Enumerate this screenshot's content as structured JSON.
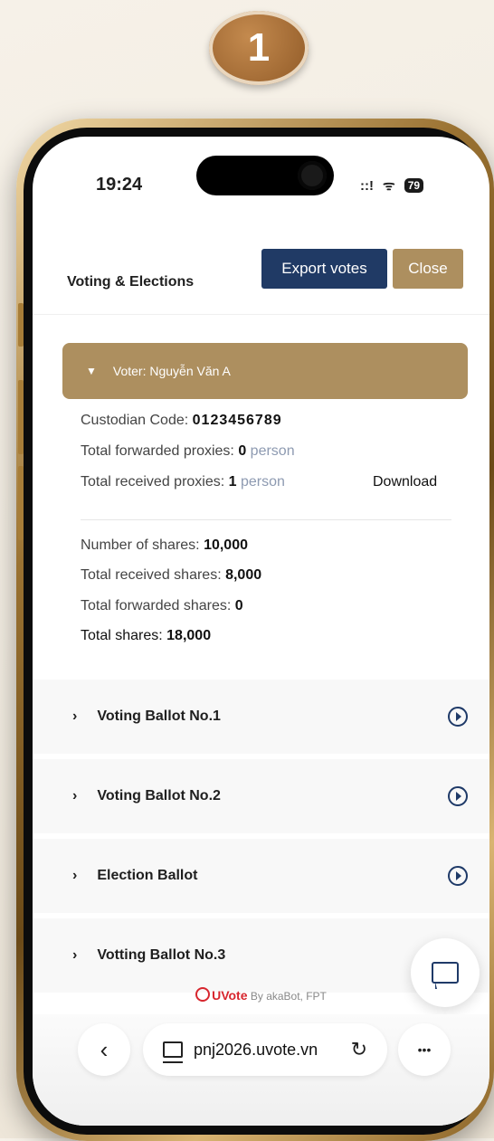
{
  "step_badge": "1",
  "status_bar": {
    "time": "19:24",
    "signal": "::!",
    "wifi": "ᯤ",
    "battery": "79"
  },
  "modal": {
    "title": "Voting & Elections",
    "export_label": "Export votes",
    "close_label": "Close"
  },
  "voter": {
    "header": "Voter: Nguyễn Văn A",
    "custodian_label": "Custodian Code: ",
    "custodian_code": "0123456789",
    "forwarded_proxies_label": "Total forwarded proxies: ",
    "forwarded_proxies_value": "0",
    "received_proxies_label": "Total received proxies: ",
    "received_proxies_value": "1",
    "person_unit": "person",
    "download_label": "Download",
    "shares_label": "Number of shares: ",
    "shares_value": "10,000",
    "received_shares_label": "Total received shares: ",
    "received_shares_value": "8,000",
    "forwarded_shares_label": "Total forwarded shares: ",
    "forwarded_shares_value": "0",
    "total_shares_label": "Total shares: ",
    "total_shares_value": "18,000"
  },
  "ballots": [
    {
      "label": "Voting Ballot No.1"
    },
    {
      "label": "Voting Ballot No.2"
    },
    {
      "label": "Election Ballot"
    },
    {
      "label": "Votting Ballot No.3"
    }
  ],
  "footer": {
    "logo_text": "UVote",
    "by_text": "By akaBot, FPT"
  },
  "browser": {
    "url": "pnj2026.uvote.vn",
    "back": "‹",
    "more": "•••",
    "reload": "↻"
  }
}
